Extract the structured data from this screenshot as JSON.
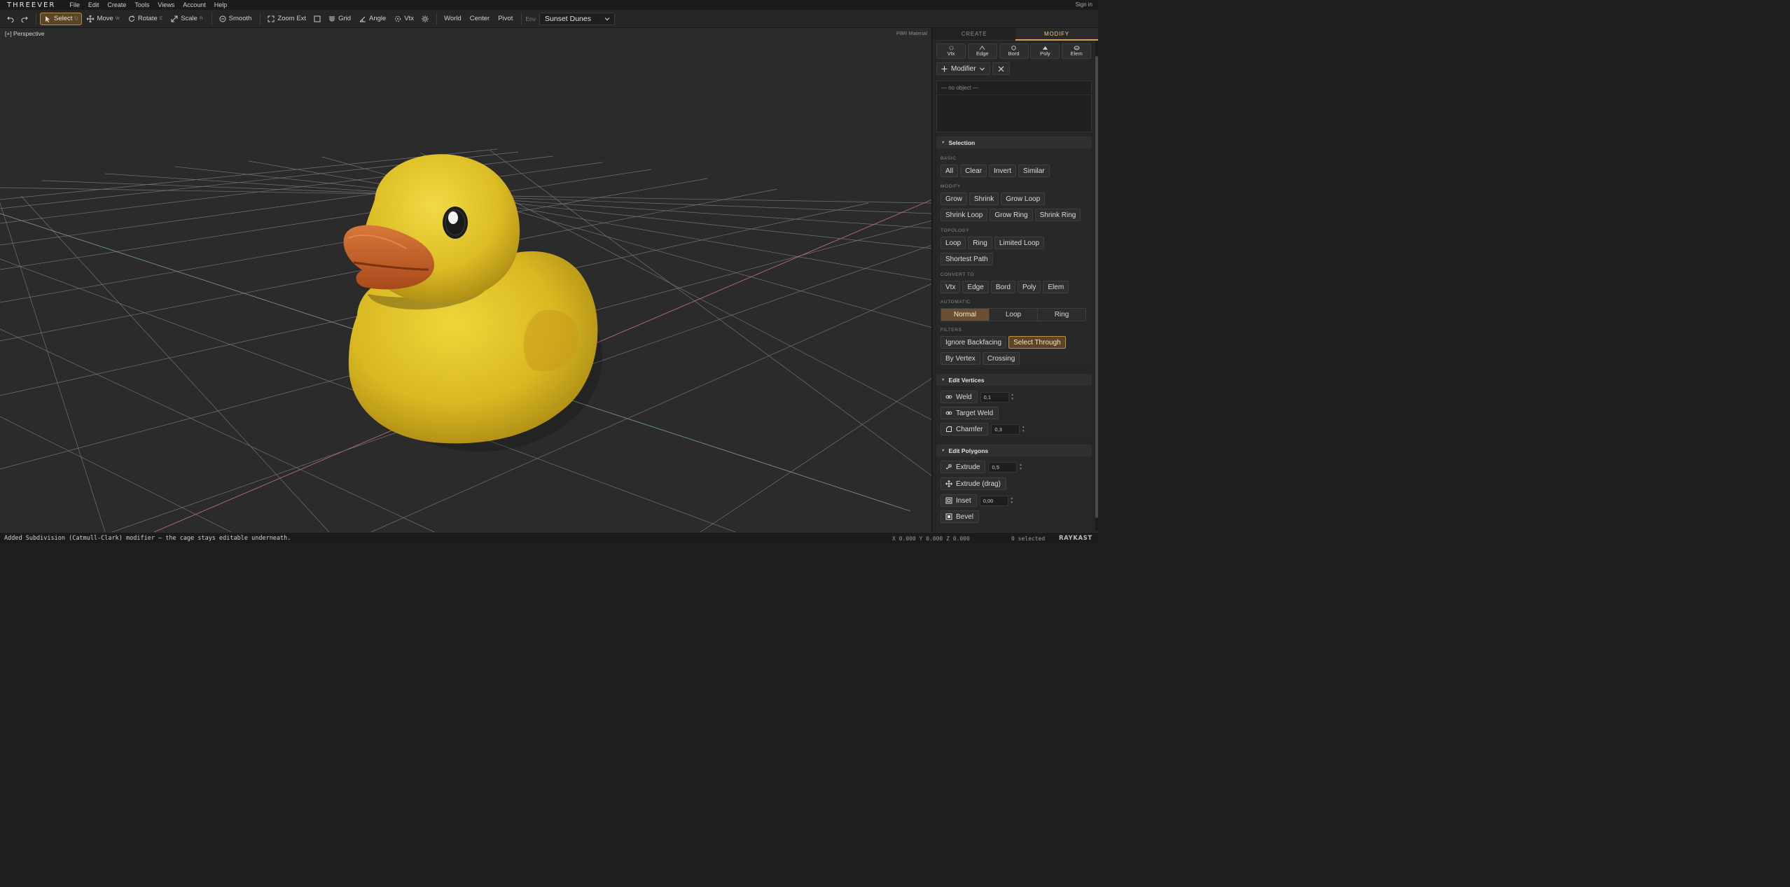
{
  "app": {
    "logo": "THREEVER",
    "sign_in": "Sign in"
  },
  "menu": [
    "File",
    "Edit",
    "Create",
    "Tools",
    "Views",
    "Account",
    "Help"
  ],
  "toolbar": {
    "select": {
      "label": "Select",
      "key": "Q"
    },
    "move": {
      "label": "Move",
      "key": "W"
    },
    "rotate": {
      "label": "Rotate",
      "key": "E"
    },
    "scale": {
      "label": "Scale",
      "key": "R"
    },
    "smooth": "Smooth",
    "zoom_ext": "Zoom Ext",
    "grid": "Grid",
    "angle": "Angle",
    "vtx": "Vtx",
    "world": "World",
    "center": "Center",
    "pivot": "Pivot",
    "env_label": "Env",
    "env_value": "Sunset Dunes"
  },
  "viewport": {
    "label": "[+] Perspective",
    "material": "PBR Material"
  },
  "panel": {
    "tabs": [
      "CREATE",
      "MODIFY"
    ],
    "active_tab": "MODIFY",
    "subobjects": [
      "Vtx",
      "Edge",
      "Bord",
      "Poly",
      "Elem"
    ],
    "modifier_label": "Modifier",
    "stack_empty": "— no object —",
    "selection": {
      "title": "Selection",
      "basic_label": "BASIC",
      "basic": [
        "All",
        "Clear",
        "Invert",
        "Similar"
      ],
      "modify_label": "MODIFY",
      "modify_row1": [
        "Grow",
        "Shrink",
        "Grow Loop"
      ],
      "modify_row2": [
        "Shrink Loop",
        "Grow Ring",
        "Shrink Ring"
      ],
      "topology_label": "TOPOLOGY",
      "topology_row1": [
        "Loop",
        "Ring",
        "Limited Loop"
      ],
      "topology_row2": [
        "Shortest Path"
      ],
      "convert_label": "CONVERT TO",
      "convert": [
        "Vtx",
        "Edge",
        "Bord",
        "Poly",
        "Elem"
      ],
      "automatic_label": "AUTOMATIC",
      "automatic": [
        "Normal",
        "Loop",
        "Ring"
      ],
      "automatic_active": "Normal",
      "filters_label": "FILTERS",
      "filters_row1": [
        "Ignore Backfacing",
        "Select Through"
      ],
      "filters_row2": [
        "By Vertex",
        "Crossing"
      ],
      "filters_active": "Select Through"
    },
    "edit_vertices": {
      "title": "Edit Vertices",
      "weld": "Weld",
      "weld_value": "0,1",
      "target_weld": "Target Weld",
      "chamfer": "Chamfer",
      "chamfer_value": "0,3"
    },
    "edit_polygons": {
      "title": "Edit Polygons",
      "extrude": "Extrude",
      "extrude_value": "0,5",
      "extrude_drag": "Extrude (drag)",
      "inset": "Inset",
      "inset_value": "0,00",
      "bevel": "Bevel"
    }
  },
  "status": {
    "message": "Added Subdivision (Catmull-Clark) modifier — the cage stays editable underneath.",
    "coords": "X 0.000 Y 0.000 Z 0.000",
    "selected": "0 selected",
    "brand": "RAYKAST"
  },
  "colors": {
    "accent": "#d4a055",
    "active_bg": "#5a4626",
    "duck_body": "#e3c12a",
    "duck_beak": "#c8662a",
    "grid": "#8a8a8a",
    "axis_x": "#b86b74",
    "axis_z": "#6f9a6f"
  }
}
